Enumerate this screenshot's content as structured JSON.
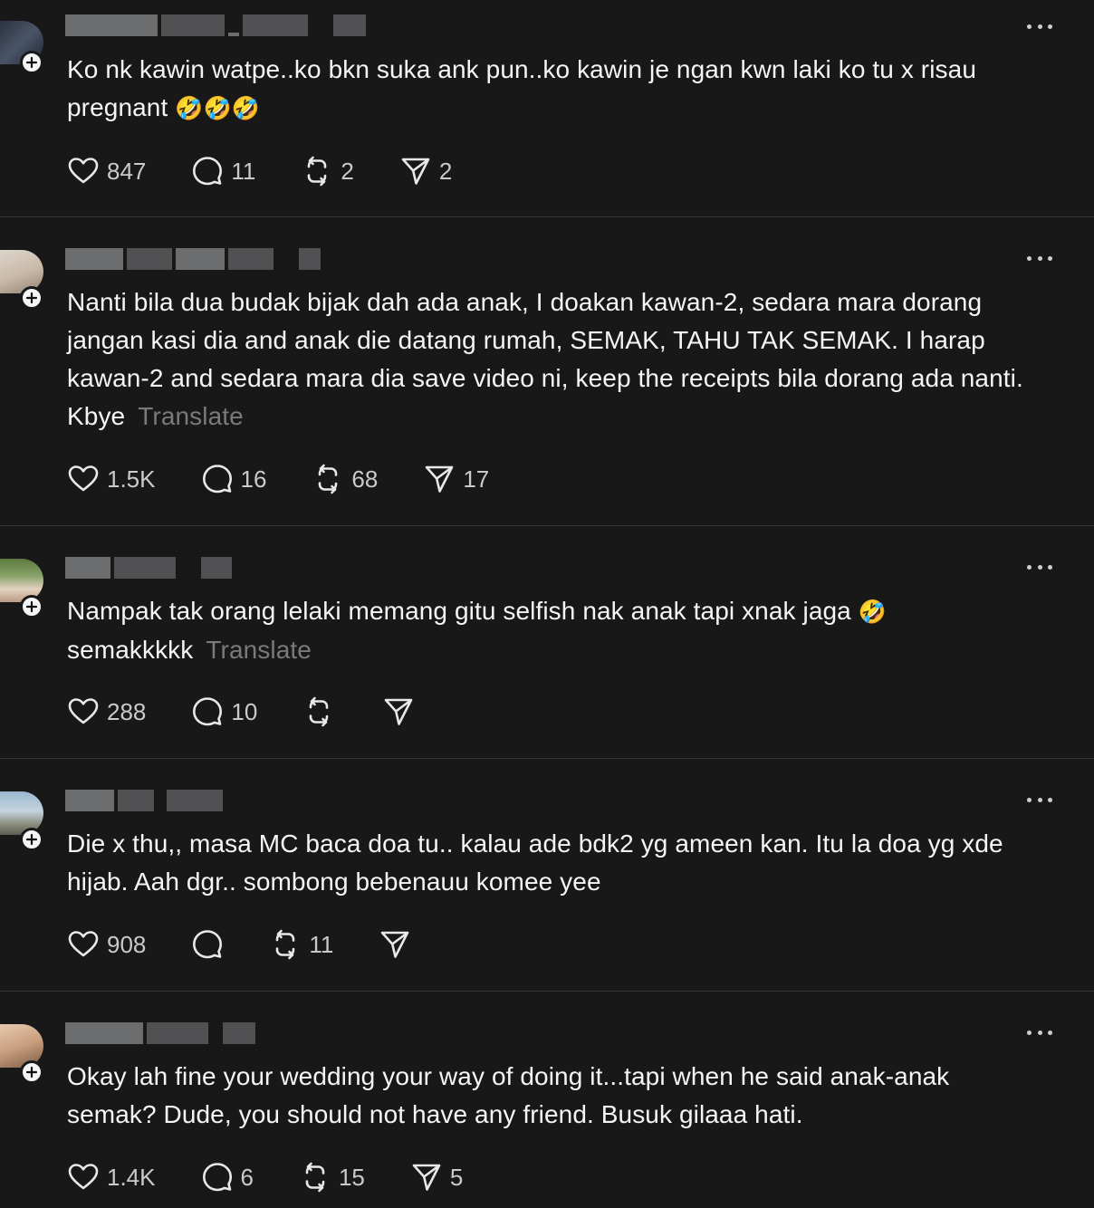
{
  "threads": [
    {
      "text": "Ko nk kawin watpe..ko bkn suka ank pun..ko kawin je ngan kwn laki ko tu x risau",
      "text2": "pregnant",
      "emoji": "🤣🤣🤣",
      "translate": "",
      "likes": "847",
      "replies": "11",
      "reposts": "2",
      "shares": "2"
    },
    {
      "text": "Nanti bila dua budak bijak dah ada anak, I doakan kawan-2, sedara mara dorang jangan kasi dia and anak die datang rumah, SEMAK, TAHU TAK SEMAK. I harap kawan-2 and sedara mara dia save video ni, keep the receipts bila dorang ada nanti. Kbye",
      "emoji": "",
      "translate": "Translate",
      "likes": "1.5K",
      "replies": "16",
      "reposts": "68",
      "shares": "17"
    },
    {
      "text": "Nampak tak orang lelaki memang gitu selfish nak anak tapi xnak jaga",
      "emoji": "🤣",
      "text2": "semakkkkk",
      "translate": "Translate",
      "likes": "288",
      "replies": "10",
      "reposts": "",
      "shares": ""
    },
    {
      "text": "Die x thu,, masa MC baca doa tu.. kalau ade bdk2 yg ameen kan. Itu la doa yg xde hijab. Aah dgr.. sombong bebenauu komee yee",
      "emoji": "",
      "translate": "",
      "likes": "908",
      "replies": "",
      "reposts": "11",
      "shares": ""
    },
    {
      "text": "Okay lah fine your wedding your way of doing it...tapi when he said anak-anak semak? Dude, you should not have any friend. Busuk gilaaa hati.",
      "emoji": "",
      "translate": "",
      "likes": "1.4K",
      "replies": "6",
      "reposts": "15",
      "shares": "5"
    }
  ],
  "icons": {
    "like": "heart-icon",
    "reply": "comment-icon",
    "repost": "repost-icon",
    "share": "send-icon",
    "more": "more-icon",
    "follow": "plus-icon"
  },
  "colors": {
    "background": "#181818",
    "text": "#f3f5f7",
    "muted": "#7a7a7a",
    "divider": "#333638"
  }
}
